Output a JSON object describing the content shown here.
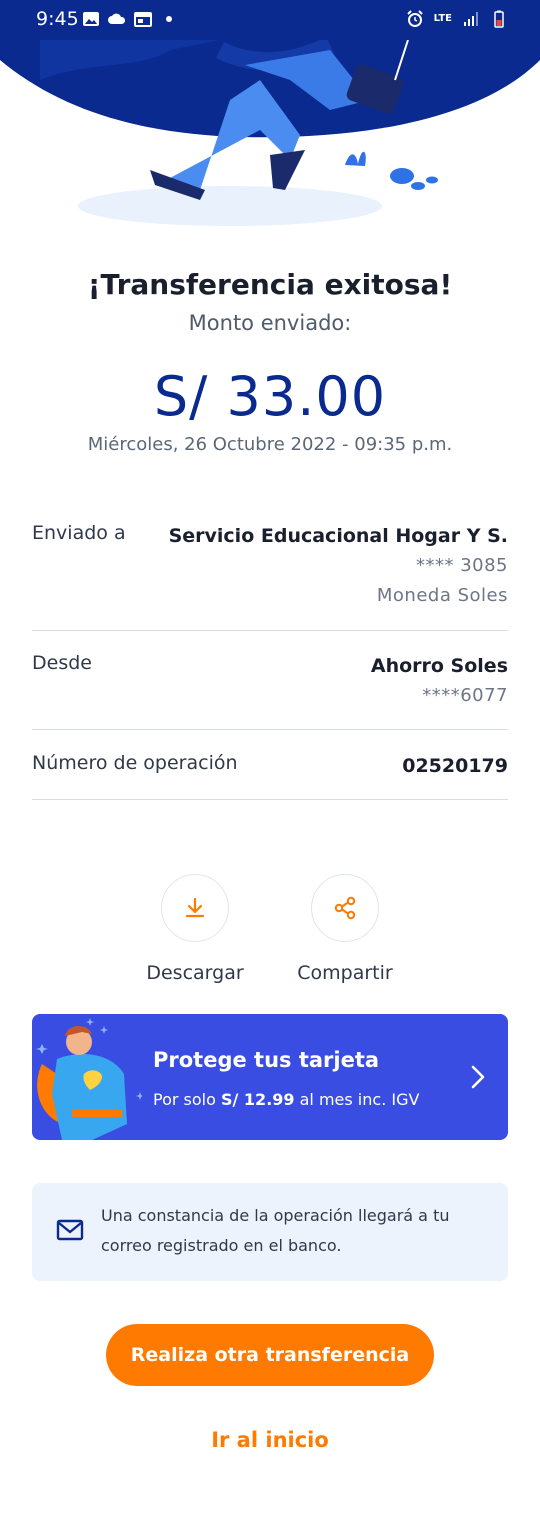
{
  "status_bar": {
    "time": "9:45",
    "network": "LTE",
    "icons_left": [
      "image-icon",
      "cloud-icon",
      "calendar-icon",
      "dot-icon"
    ],
    "icons_right": [
      "alarm-icon",
      "lte-icon",
      "signal-icon",
      "battery-icon"
    ]
  },
  "result": {
    "title": "¡Transferencia exitosa!",
    "subtitle": "Monto enviado:",
    "amount": "S/ 33.00",
    "datetime": "Miércoles, 26 Octubre 2022 - 09:35 p.m."
  },
  "details": {
    "sent_to": {
      "label": "Enviado a",
      "name": "Servicio Educacional Hogar Y S.",
      "account": "**** 3085",
      "currency": "Moneda Soles"
    },
    "from": {
      "label": "Desde",
      "account_name": "Ahorro Soles",
      "account": "****6077"
    },
    "operation": {
      "label": "Número de operación",
      "number": "02520179"
    }
  },
  "actions": {
    "download_label": "Descargar",
    "share_label": "Compartir"
  },
  "promo": {
    "title": "Protege tus tarjeta",
    "text_prefix": "Por solo ",
    "price": "S/ 12.99",
    "text_suffix": " al mes inc. IGV"
  },
  "notice": {
    "text": "Una constancia de la operación llegará a tu correo registrado en el banco."
  },
  "buttons": {
    "primary": "Realiza otra transferencia",
    "home": "Ir al inicio"
  },
  "colors": {
    "brand_blue": "#0a2a8f",
    "accent_orange": "#ff7a00",
    "promo_blue": "#3a4de3",
    "notice_bg": "#edf3fd"
  }
}
